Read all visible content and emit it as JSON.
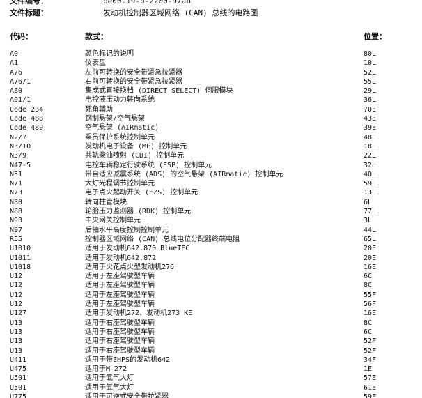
{
  "document": {
    "doc_number_label": "文件编号：",
    "doc_number_value": "pe00.19-p-2200-97ab",
    "doc_title_label": "文件标题：",
    "doc_title_value": "发动机控制器区域网络 (CAN) 总线的电路图"
  },
  "table": {
    "headers": {
      "code": "代码：",
      "description": "款式：",
      "position": "位置："
    },
    "rows": [
      {
        "code": "A0",
        "description": "颜色标记的说明",
        "position": "80L"
      },
      {
        "code": "A1",
        "description": "仪表盘",
        "position": "10L"
      },
      {
        "code": "A76",
        "description": "左前可转换的安全带紧急拉紧器",
        "position": "52L"
      },
      {
        "code": "A76/1",
        "description": "右前可转换的安全带紧急拉紧器",
        "position": "55L"
      },
      {
        "code": "A80",
        "description": "集成式直接换档 (DIRECT SELECT) 伺服模块",
        "position": "29L"
      },
      {
        "code": "A91/1",
        "description": "电控液压动力转向系统",
        "position": "36L"
      },
      {
        "code": "Code 234",
        "description": "死角辅助",
        "position": "70E"
      },
      {
        "code": "Code 488",
        "description": "钢制悬架/空气悬架",
        "position": "43E"
      },
      {
        "code": "Code 489",
        "description": "空气悬架 (AIRmatic)",
        "position": "39E"
      },
      {
        "code": "N2/7",
        "description": "乘员保护系统控制单元",
        "position": "48L"
      },
      {
        "code": "N3/10",
        "description": "发动机电子设备 (ME) 控制单元",
        "position": "18L"
      },
      {
        "code": "N3/9",
        "description": "共轨柴油喷射 (CDI) 控制单元",
        "position": "22L"
      },
      {
        "code": "N47-5",
        "description": "电控车辆稳定行驶系统 (ESP) 控制单元",
        "position": "32L"
      },
      {
        "code": "N51",
        "description": "带自适应减震系统 (ADS) 的空气悬架 (AIRmatic) 控制单元",
        "position": "40L"
      },
      {
        "code": "N71",
        "description": "大灯光程调节控制单元",
        "position": "59L"
      },
      {
        "code": "N73",
        "description": "电子点火起动开关 (EZS) 控制单元",
        "position": "13L"
      },
      {
        "code": "N80",
        "description": "转向柱管模块",
        "position": "6L"
      },
      {
        "code": "N88",
        "description": "轮胎压力监测器 (RDK) 控制单元",
        "position": "77L"
      },
      {
        "code": "N93",
        "description": "中央网关控制单元",
        "position": "3L"
      },
      {
        "code": "N97",
        "description": "后轴水平高度控制控制单元",
        "position": "44L"
      },
      {
        "code": "R55",
        "description": "控制器区域网络 (CAN) 总线电位分配器终端电阻",
        "position": "65L"
      },
      {
        "code": "U1010",
        "description": "适用于发动机642.870 BlueTEC",
        "position": "20E"
      },
      {
        "code": "U1011",
        "description": "适用于发动机642.872",
        "position": "20E"
      },
      {
        "code": "U1018",
        "description": "适用于火花点火型发动机276",
        "position": "16E"
      },
      {
        "code": "U12",
        "description": "适用于左座驾驶型车辆",
        "position": "6C"
      },
      {
        "code": "U12",
        "description": "适用于左座驾驶型车辆",
        "position": "8C"
      },
      {
        "code": "U12",
        "description": "适用于左座驾驶型车辆",
        "position": "55F"
      },
      {
        "code": "U12",
        "description": "适用于左座驾驶型车辆",
        "position": "56F"
      },
      {
        "code": "U127",
        "description": "适用于发动机272、发动机273 KE",
        "position": "16E"
      },
      {
        "code": "U13",
        "description": "适用于右座驾驶型车辆",
        "position": "8C"
      },
      {
        "code": "U13",
        "description": "适用于右座驾驶型车辆",
        "position": "6C"
      },
      {
        "code": "U13",
        "description": "适用于右座驾驶型车辆",
        "position": "52F"
      },
      {
        "code": "U13",
        "description": "适用于右座驾驶型车辆",
        "position": "52F"
      },
      {
        "code": "U411",
        "description": "适用于带EHPS的发动机642",
        "position": "34F"
      },
      {
        "code": "U475",
        "description": "适用于M 272",
        "position": "1E"
      },
      {
        "code": "U501",
        "description": "适用于氙气大灯",
        "position": "57E"
      },
      {
        "code": "U501",
        "description": "适用于氙气大灯",
        "position": "61E"
      },
      {
        "code": "U775",
        "description": "适用于可逆式安全带拉紧器",
        "position": "59E"
      }
    ]
  }
}
